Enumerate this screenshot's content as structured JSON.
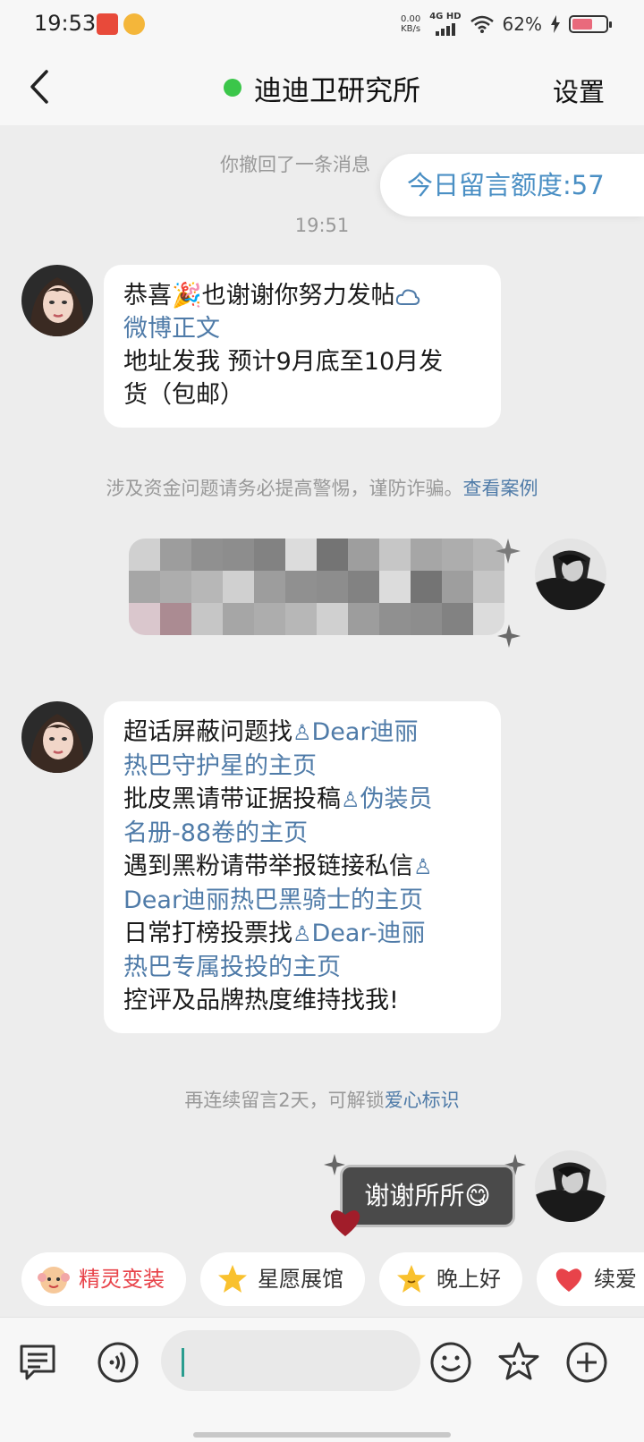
{
  "status_bar": {
    "time": "19:53",
    "net_speed": "0.00",
    "net_speed_unit": "KB/s",
    "net_type": "4G HD",
    "battery": "62%",
    "battery_level": 0.62
  },
  "header": {
    "title": "迪迪卫研究所",
    "settings_label": "设置"
  },
  "chat": {
    "recall_notice": "你撤回了一条消息",
    "quota_label": "今日留言额度:57",
    "timestamp": "19:51",
    "message1": {
      "line1": "恭喜🎉也谢谢你努力发帖",
      "link": "微博正文",
      "line3": "地址发我 预计9月底至10月发",
      "line4": "货（包邮）"
    },
    "warning_text": "涉及资金问题请务必提高警惕，谨防诈骗。",
    "warning_link": "查看案例",
    "message2": {
      "l1_text": "超话屏蔽问题找",
      "l1_link": "Dear迪丽",
      "l2_link": "热巴守护星的主页",
      "l3_text": "批皮黑请带证据投稿",
      "l3_link": "伪装员",
      "l4_link": "名册-88卷的主页",
      "l5_text": "遇到黑粉请带举报链接私信",
      "l6_link": "Dear迪丽热巴黑骑士的主页",
      "l7_text": "日常打榜投票找",
      "l7_link": "Dear-迪丽",
      "l8_link": "热巴专属投投的主页",
      "l9_text": "控评及品牌热度维持找我!"
    },
    "streak_text": "再连续留言2天，可解锁",
    "streak_link": "爱心标识",
    "my_message": "谢谢所所😋"
  },
  "quick_replies": [
    {
      "label": "精灵变装",
      "icon": "monkey-face-icon"
    },
    {
      "label": "星愿展馆",
      "icon": "star-icon"
    },
    {
      "label": "晚上好",
      "icon": "smiling-star-icon"
    },
    {
      "label": "续爱",
      "icon": "heart-icon"
    }
  ],
  "input_bar": {
    "placeholder": "",
    "icons": [
      "list-icon",
      "voice-icon",
      "emoji-icon",
      "sticker-icon",
      "plus-icon"
    ]
  },
  "colors": {
    "accent_link": "#4f7ba8",
    "online": "#3bc64a",
    "background": "#ededed"
  }
}
